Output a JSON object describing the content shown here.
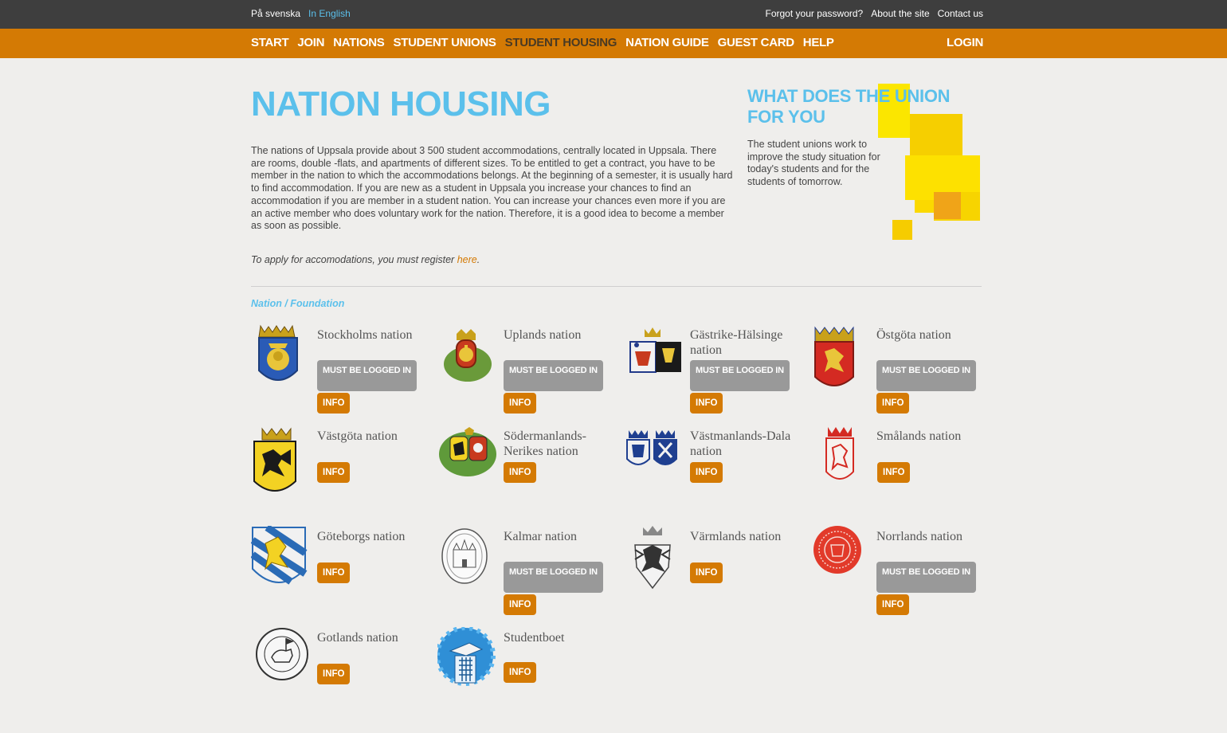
{
  "topbar": {
    "lang_sv": "På svenska",
    "lang_en": "In English",
    "forgot": "Forgot your password?",
    "about": "About the site",
    "contact": "Contact us"
  },
  "nav": {
    "items": [
      "START",
      "JOIN",
      "NATIONS",
      "STUDENT UNIONS",
      "STUDENT HOUSING",
      "NATION GUIDE",
      "GUEST CARD",
      "HELP"
    ],
    "active": "STUDENT HOUSING",
    "login": "LOGIN"
  },
  "main": {
    "title": "NATION HOUSING",
    "intro": "The nations of Uppsala provide about 3 500 student accommodations, centrally located in Uppsala. There are rooms, double -flats, and apartments of different sizes. To be entitled to get a contract, you have to be member in the nation to which the accommodations belongs. At the beginning of a semester, it is usually hard to find accommodation. If you are new as a student in Uppsala you increase your chances to find an accommodation if you are member in a student nation. You can increase your chances even more if you are an active member who does voluntary work for the nation. Therefore, it is a good idea to become a member as soon as possible.",
    "apply_prefix": "To apply for accomodations, you must register ",
    "apply_link": "here",
    "apply_suffix": ".",
    "section_label": "Nation / Foundation"
  },
  "side": {
    "title": "WHAT DOES THE UNION FOR YOU",
    "text": "The student unions work to improve the study situation for today's students and for the students of tomorrow."
  },
  "buttons": {
    "logged": "MUST BE LOGGED IN",
    "info": "INFO"
  },
  "nations": [
    {
      "name": "Stockholms nation",
      "logged": true,
      "crest": "stockholms-crest-icon"
    },
    {
      "name": "Uplands nation",
      "logged": true,
      "crest": "uplands-crest-icon"
    },
    {
      "name": "Gästrike-Hälsinge nation",
      "logged": true,
      "crest": "gastrike-halsinge-crest-icon"
    },
    {
      "name": "Östgöta nation",
      "logged": true,
      "crest": "ostgota-crest-icon"
    },
    {
      "name": "Västgöta nation",
      "logged": false,
      "crest": "vastgota-crest-icon"
    },
    {
      "name": "Södermanlands-Nerikes nation",
      "logged": false,
      "crest": "sodermanlands-nerikes-crest-icon"
    },
    {
      "name": "Västmanlands-Dala nation",
      "logged": false,
      "crest": "vastmanlands-dala-crest-icon"
    },
    {
      "name": "Smålands nation",
      "logged": false,
      "crest": "smalands-crest-icon"
    },
    {
      "name": "Göteborgs nation",
      "logged": false,
      "crest": "goteborgs-crest-icon"
    },
    {
      "name": "Kalmar nation",
      "logged": true,
      "crest": "kalmar-crest-icon"
    },
    {
      "name": "Värmlands nation",
      "logged": false,
      "crest": "varmlands-crest-icon"
    },
    {
      "name": "Norrlands nation",
      "logged": true,
      "crest": "norrlands-crest-icon"
    },
    {
      "name": "Gotlands nation",
      "logged": false,
      "crest": "gotlands-crest-icon"
    },
    {
      "name": "Studentboet",
      "logged": false,
      "crest": "studentboet-logo-icon"
    }
  ],
  "colors": {
    "accent_orange": "#d47a04",
    "accent_blue": "#5bc0eb",
    "topbar": "#3e3e3e"
  }
}
